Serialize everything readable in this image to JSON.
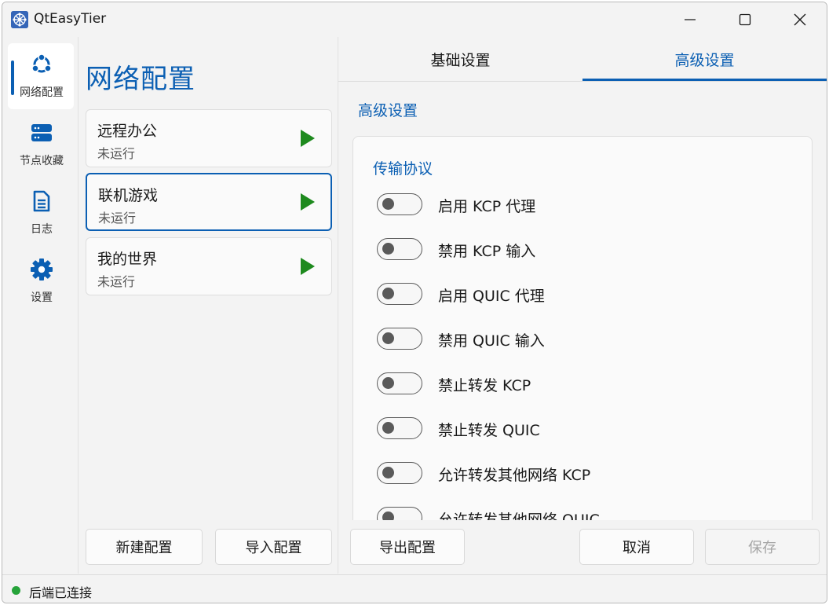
{
  "window": {
    "title": "QtEasyTier",
    "controls": [
      "minimize-icon",
      "maximize-icon",
      "close-icon"
    ]
  },
  "nav": {
    "items": [
      {
        "label": "网络配置",
        "icon": "network-icon",
        "active": true
      },
      {
        "label": "节点收藏",
        "icon": "server-icon",
        "active": false
      },
      {
        "label": "日志",
        "icon": "document-icon",
        "active": false
      },
      {
        "label": "设置",
        "icon": "gear-icon",
        "active": false
      }
    ]
  },
  "configs": {
    "title": "网络配置",
    "items": [
      {
        "name": "远程办公",
        "status": "未运行",
        "selected": false,
        "action_icon": "play-icon"
      },
      {
        "name": "联机游戏",
        "status": "未运行",
        "selected": true,
        "action_icon": "play-icon"
      },
      {
        "name": "我的世界",
        "status": "未运行",
        "selected": false,
        "action_icon": "play-icon"
      }
    ],
    "new_button": "新建配置",
    "import_button": "导入配置"
  },
  "editor": {
    "tabs": [
      {
        "label": "基础设置",
        "active": false
      },
      {
        "label": "高级设置",
        "active": true
      }
    ],
    "section_title": "高级设置",
    "group_title": "传输协议",
    "options": [
      {
        "label": "启用 KCP 代理",
        "on": false
      },
      {
        "label": "禁用 KCP 输入",
        "on": false
      },
      {
        "label": "启用 QUIC 代理",
        "on": false
      },
      {
        "label": "禁用 QUIC 输入",
        "on": false
      },
      {
        "label": "禁止转发 KCP",
        "on": false
      },
      {
        "label": "禁止转发 QUIC",
        "on": false
      },
      {
        "label": "允许转发其他网络 KCP",
        "on": false
      },
      {
        "label": "允许转发其他网络 QUIC",
        "on": false
      }
    ],
    "export_button": "导出配置",
    "cancel_button": "取消",
    "save_button": "保存",
    "save_enabled": false
  },
  "status": {
    "text": "后端已连接",
    "color": "#26a33a"
  },
  "colors": {
    "accent": "#0b5fb3",
    "play": "#1e8a1e"
  }
}
